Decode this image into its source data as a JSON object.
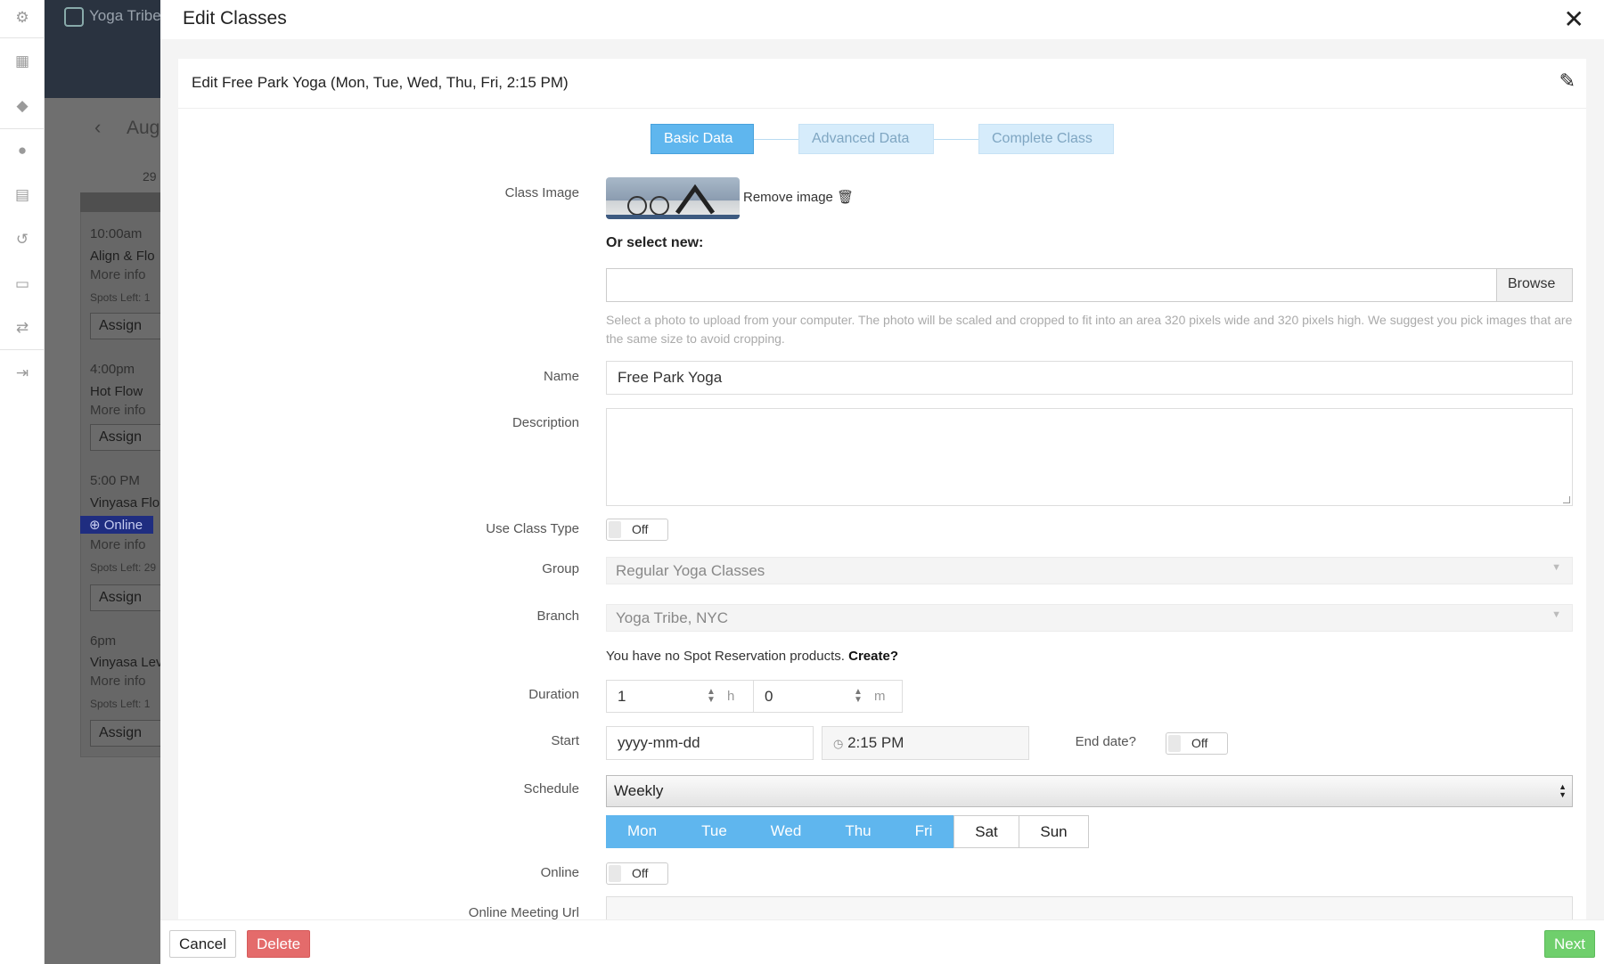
{
  "background": {
    "brand": "Yoga Tribe",
    "month": "Aug",
    "day_number": "29",
    "events": [
      {
        "time": "10:00am",
        "name": "Align & Flo",
        "more": "More info",
        "spots": "Spots Left: 1",
        "assign": "Assign"
      },
      {
        "time": "4:00pm",
        "name": "Hot Flow",
        "more": "More info",
        "assign": "Assign"
      },
      {
        "time": "5:00 PM",
        "name": "Vinyasa Flo",
        "badge": "Online",
        "more": "More info",
        "spots": "Spots Left: 29",
        "assign": "Assign"
      },
      {
        "time": "6pm",
        "name": "Vinyasa Lev",
        "more": "More info",
        "spots": "Spots Left: 1",
        "assign": "Assign"
      }
    ]
  },
  "modal": {
    "title": "Edit Classes",
    "panel_title": "Edit Free Park Yoga (Mon, Tue, Wed, Thu, Fri, 2:15 PM)"
  },
  "steps": [
    "Basic Data",
    "Advanced Data",
    "Complete Class"
  ],
  "form": {
    "class_image_label": "Class Image",
    "remove_image": "Remove image",
    "or_select_new": "Or select new:",
    "browse": "Browse",
    "upload_help": "Select a photo to upload from your computer. The photo will be scaled and cropped to fit into an area 320 pixels wide and 320 pixels high. We suggest you pick images that are the same size to avoid cropping.",
    "name_label": "Name",
    "name_value": "Free Park Yoga",
    "description_label": "Description",
    "use_class_type_label": "Use Class Type",
    "toggle_off": "Off",
    "group_label": "Group",
    "group_value": "Regular Yoga Classes",
    "branch_label": "Branch",
    "branch_value": "Yoga Tribe, NYC",
    "notice_text": "You have no Spot Reservation products.",
    "notice_link": "Create?",
    "duration_label": "Duration",
    "duration_hours": "1",
    "duration_hours_unit": "h",
    "duration_minutes": "0",
    "duration_minutes_unit": "m",
    "start_label": "Start",
    "start_date_placeholder": "yyyy-mm-dd",
    "start_time": "2:15 PM",
    "end_date_label": "End date?",
    "schedule_label": "Schedule",
    "schedule_value": "Weekly",
    "days": [
      {
        "label": "Mon",
        "active": true
      },
      {
        "label": "Tue",
        "active": true
      },
      {
        "label": "Wed",
        "active": true
      },
      {
        "label": "Thu",
        "active": true
      },
      {
        "label": "Fri",
        "active": true
      },
      {
        "label": "Sat",
        "active": false
      },
      {
        "label": "Sun",
        "active": false
      }
    ],
    "online_label": "Online",
    "online_url_label": "Online Meeting Url"
  },
  "footer": {
    "cancel": "Cancel",
    "delete": "Delete",
    "next": "Next"
  },
  "colors": {
    "primary": "#5fb6ee",
    "danger": "#e46b6b",
    "success": "#6fcf6c"
  }
}
